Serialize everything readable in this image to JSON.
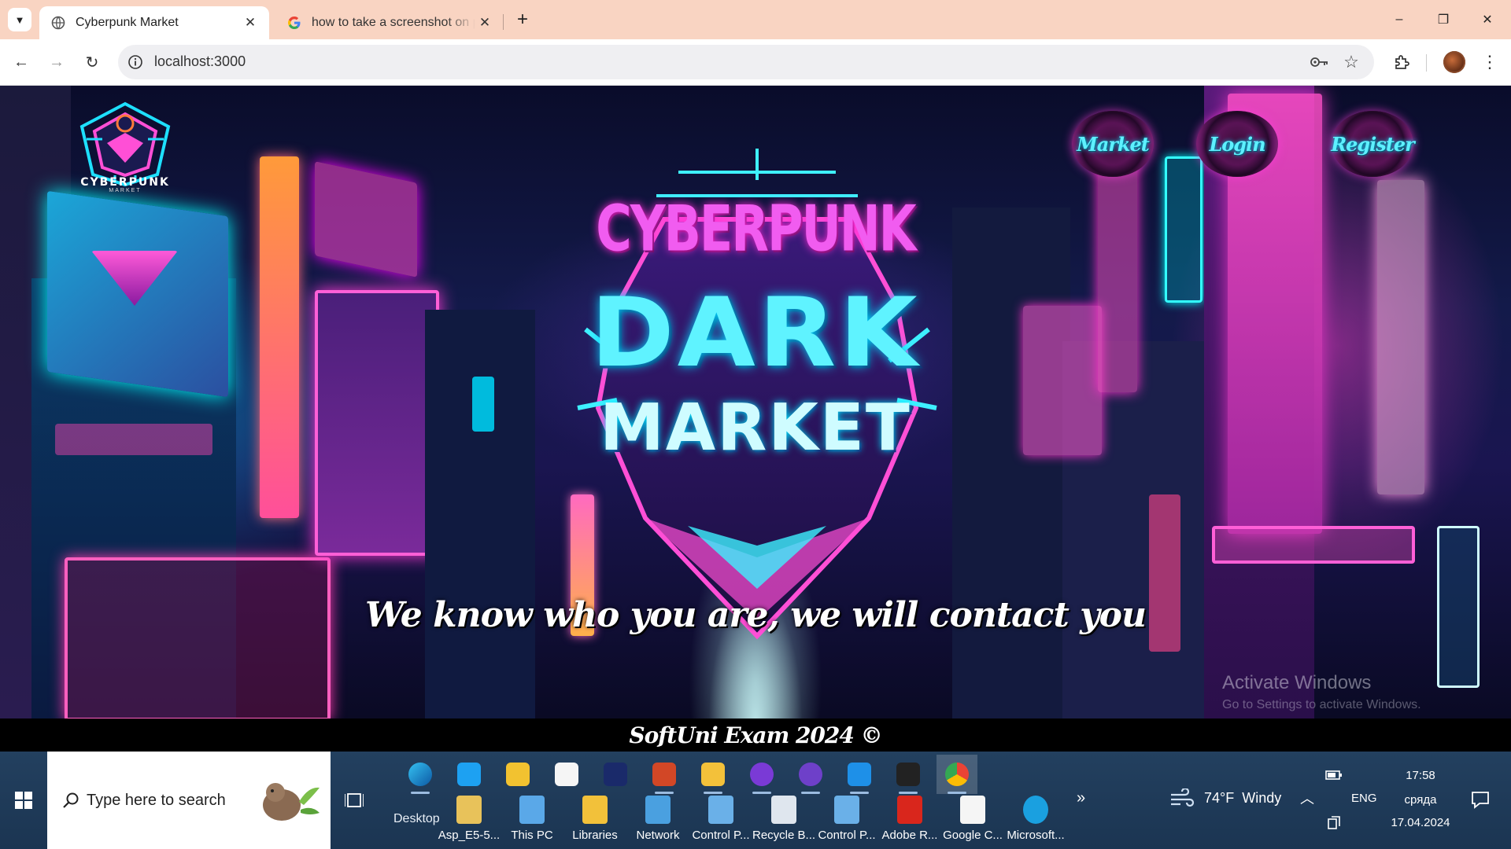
{
  "browser": {
    "tabs": [
      {
        "title": "Cyberpunk Market",
        "active": true
      },
      {
        "title": "how to take a screenshot on pc",
        "active": false
      }
    ],
    "url": "localhost:3000",
    "controls": {
      "minimize": "–",
      "restore": "❐",
      "close": "✕"
    }
  },
  "page": {
    "logo": {
      "title": "CYBERPUNK",
      "subtitle": "MARKET"
    },
    "nav": [
      {
        "label": "Market"
      },
      {
        "label": "Login"
      },
      {
        "label": "Register"
      }
    ],
    "emblem": {
      "line1": "CYBERPUNK",
      "line2": "DARK",
      "line3": "MARKET"
    },
    "slogan": "We know who you are, we will contact you",
    "footer": "SoftUni Exam 2024 ©",
    "watermark": {
      "title": "Activate Windows",
      "subtitle": "Go to Settings to activate Windows."
    }
  },
  "taskbar": {
    "search_placeholder": "Type here to search",
    "desktop_label": "Desktop",
    "pinned_icons": [
      "edge-icon",
      "ie-icon",
      "app-icon",
      "store-icon",
      "network-app-icon",
      "powerpoint-icon",
      "explorer-icon",
      "infinity-icon",
      "github-icon",
      "vscode-icon",
      "terminal-icon",
      "chrome-icon"
    ],
    "shortcuts": [
      {
        "label": "Asp_E5-5...",
        "icon": "folder-user-icon"
      },
      {
        "label": "This PC",
        "icon": "this-pc-icon"
      },
      {
        "label": "Libraries",
        "icon": "libraries-icon"
      },
      {
        "label": "Network",
        "icon": "network-icon"
      },
      {
        "label": "Control P...",
        "icon": "control-panel-icon"
      },
      {
        "label": "Recycle B...",
        "icon": "recycle-bin-icon"
      },
      {
        "label": "Control P...",
        "icon": "control-panel-icon"
      },
      {
        "label": "Adobe R...",
        "icon": "adobe-reader-icon"
      },
      {
        "label": "Google C...",
        "icon": "document-icon"
      },
      {
        "label": "Microsoft...",
        "icon": "edge-icon"
      }
    ],
    "more": "»",
    "weather": {
      "temp": "74°F",
      "condition": "Windy"
    },
    "language": "ENG",
    "clock": {
      "time": "17:58",
      "day": "сряда",
      "date": "17.04.2024"
    }
  }
}
